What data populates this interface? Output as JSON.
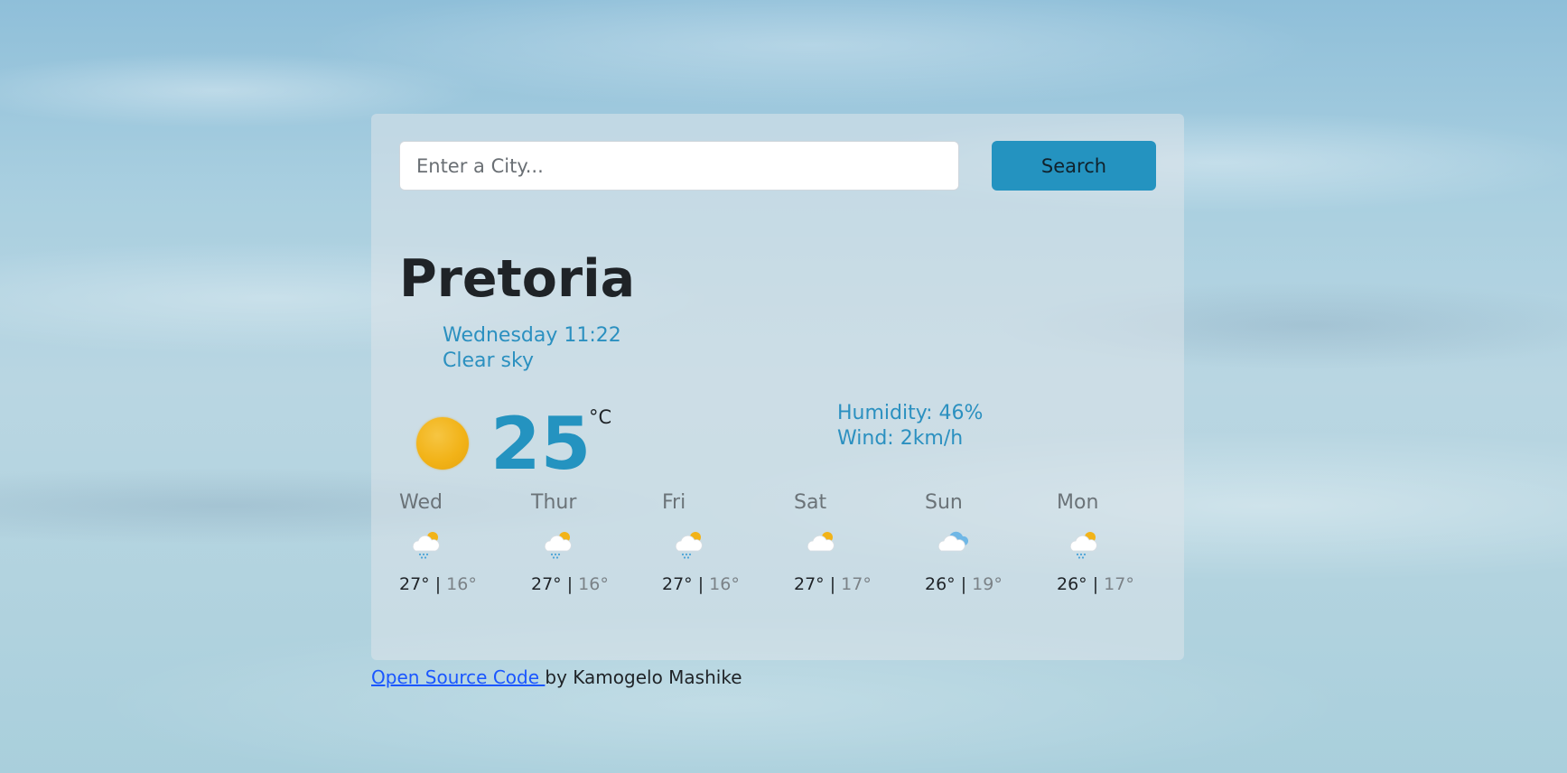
{
  "search": {
    "placeholder": "Enter a City...",
    "button_label": "Search"
  },
  "current": {
    "city": "Pretoria",
    "datetime": "Wednesday 11:22",
    "description": "Clear sky",
    "icon": "clear-sun-icon",
    "temperature": "25",
    "unit": "°C",
    "humidity_text": "Humidity: 46%",
    "wind_text": "Wind: 2km/h"
  },
  "forecast": [
    {
      "day": "Wed",
      "icon": "rain-sun-icon",
      "max": "27°",
      "min": "16°"
    },
    {
      "day": "Thur",
      "icon": "rain-sun-icon",
      "max": "27°",
      "min": "16°"
    },
    {
      "day": "Fri",
      "icon": "rain-sun-icon",
      "max": "27°",
      "min": "16°"
    },
    {
      "day": "Sat",
      "icon": "partly-cloudy-icon",
      "max": "27°",
      "min": "17°"
    },
    {
      "day": "Sun",
      "icon": "cloudy-icon",
      "max": "26°",
      "min": "19°"
    },
    {
      "day": "Mon",
      "icon": "rain-sun-icon",
      "max": "26°",
      "min": "17°"
    }
  ],
  "temp_separator": " | ",
  "footer": {
    "link_text": "Open Source Code ",
    "by_text": " by Kamogelo Mashike"
  },
  "colors": {
    "accent": "#2493c0",
    "link": "#1a56ff"
  }
}
